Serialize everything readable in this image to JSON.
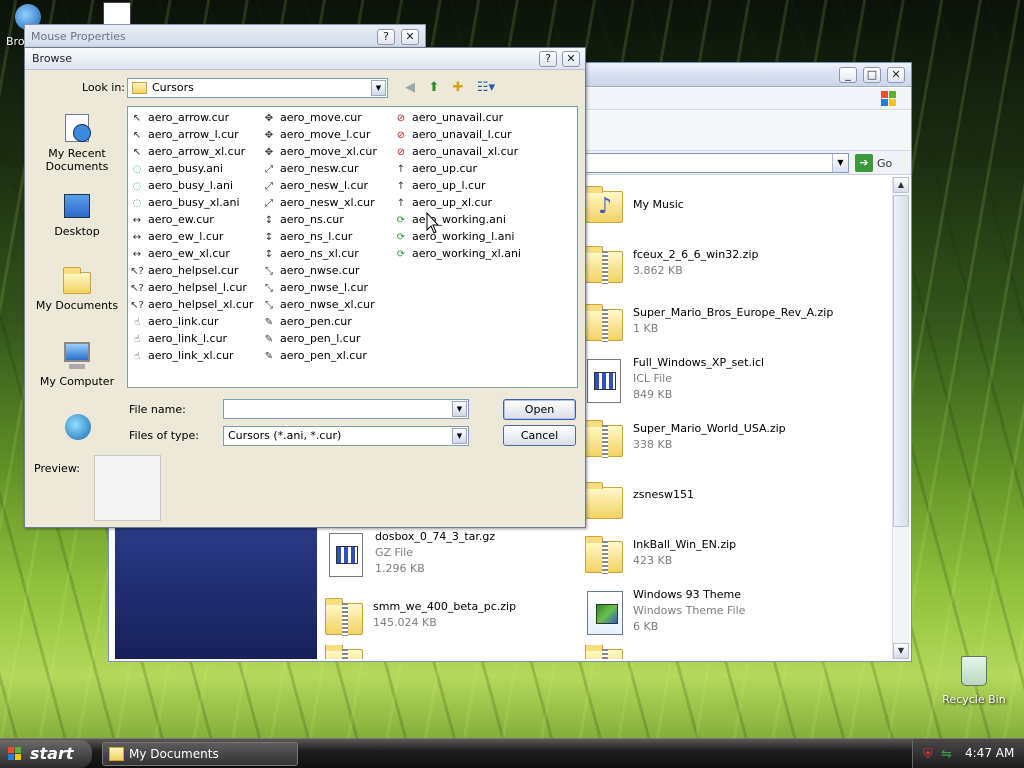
{
  "desktop": {
    "top_left_label": "Bro",
    "recycle_bin": "Recycle Bin"
  },
  "mouse_properties": {
    "title": "Mouse Properties",
    "help": "?",
    "close": "✕"
  },
  "explorer": {
    "minimize": "_",
    "maximize": "□",
    "close": "✕",
    "go_label": "Go",
    "items": [
      {
        "name": "My Music",
        "sub": "",
        "kind": "music-folder"
      },
      {
        "name": "fceux_2_6_6_win32.zip",
        "sub": "3.862 KB",
        "kind": "zip"
      },
      {
        "name": "Super_Mario_Bros_Europe_Rev_A.zip",
        "sub": "1 KB",
        "kind": "zip"
      },
      {
        "name": "Full_Windows_XP_set.icl",
        "sub": "ICL File",
        "sub2": "849 KB",
        "kind": "icl"
      },
      {
        "name": "Super_Mario_World_USA.zip",
        "sub": "338 KB",
        "kind": "zip"
      },
      {
        "name": "zsnesw151",
        "sub": "",
        "kind": "folder"
      },
      {
        "name": "dosbox_0_74_3_tar.gz",
        "sub": "GZ File",
        "sub2": "1.296 KB",
        "kind": "gz"
      },
      {
        "name": "InkBall_Win_EN.zip",
        "sub": "423 KB",
        "kind": "zip"
      },
      {
        "name": "smm_we_400_beta_pc.zip",
        "sub": "145.024 KB",
        "kind": "zip"
      },
      {
        "name": "Windows 93 Theme",
        "sub": "Windows Theme File",
        "sub2": "6 KB",
        "kind": "theme"
      }
    ]
  },
  "browse": {
    "title": "Browse",
    "help": "?",
    "close": "✕",
    "look_in_label": "Look in:",
    "look_in_value": "Cursors",
    "places": [
      {
        "label": "My Recent Documents"
      },
      {
        "label": "Desktop"
      },
      {
        "label": "My Documents"
      },
      {
        "label": "My Computer"
      },
      {
        "label": ""
      }
    ],
    "files_col1": [
      "aero_arrow.cur",
      "aero_arrow_l.cur",
      "aero_arrow_xl.cur",
      "aero_busy.ani",
      "aero_busy_l.ani",
      "aero_busy_xl.ani",
      "aero_ew.cur",
      "aero_ew_l.cur",
      "aero_ew_xl.cur",
      "aero_helpsel.cur",
      "aero_helpsel_l.cur",
      "aero_helpsel_xl.cur",
      "aero_link.cur",
      "aero_link_l.cur",
      "aero_link_xl.cur"
    ],
    "files_col2": [
      "aero_move.cur",
      "aero_move_l.cur",
      "aero_move_xl.cur",
      "aero_nesw.cur",
      "aero_nesw_l.cur",
      "aero_nesw_xl.cur",
      "aero_ns.cur",
      "aero_ns_l.cur",
      "aero_ns_xl.cur",
      "aero_nwse.cur",
      "aero_nwse_l.cur",
      "aero_nwse_xl.cur",
      "aero_pen.cur",
      "aero_pen_l.cur",
      "aero_pen_xl.cur"
    ],
    "files_col3": [
      "aero_unavail.cur",
      "aero_unavail_l.cur",
      "aero_unavail_xl.cur",
      "aero_up.cur",
      "aero_up_l.cur",
      "aero_up_xl.cur",
      "aero_working.ani",
      "aero_working_l.ani",
      "aero_working_xl.ani"
    ],
    "file_name_label": "File name:",
    "file_name_value": "",
    "files_of_type_label": "Files of type:",
    "files_of_type_value": "Cursors (*.ani, *.cur)",
    "open_label": "Open",
    "cancel_label": "Cancel",
    "preview_label": "Preview:"
  },
  "taskbar": {
    "start_label": "start",
    "task_label": "My Documents",
    "clock": "4:47 AM"
  }
}
